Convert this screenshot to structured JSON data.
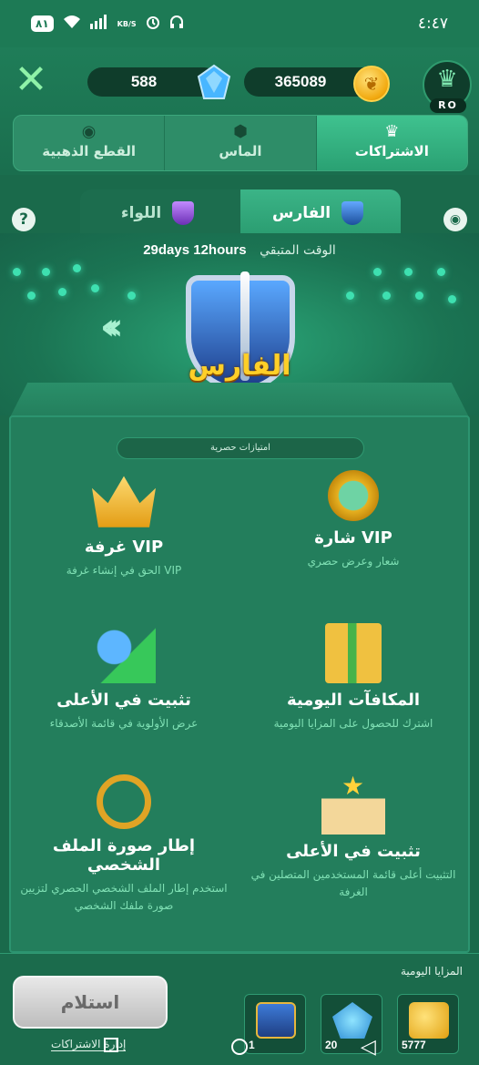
{
  "status": {
    "battery": "٨١",
    "speed_top": "KB/S",
    "clock": "٤:٤٧"
  },
  "header": {
    "diamonds": "588",
    "gold": "365089",
    "avatar_badge": "RO"
  },
  "tabs": [
    {
      "label": "القطع الذهبية",
      "icon": "coin-icon"
    },
    {
      "label": "الماس",
      "icon": "diamond-icon"
    },
    {
      "label": "الاشتراكات",
      "icon": "crown-icon"
    }
  ],
  "subtabs": {
    "active": "الفارس",
    "inactive": "اللواء"
  },
  "stage": {
    "remaining_label": "الوقت المتبقي",
    "remaining_value": "29days 12hours",
    "rank_name": "الفارس"
  },
  "panel": {
    "section_label": "امتيازات حصرية",
    "features": [
      {
        "title": "شارة VIP",
        "desc": "شعار وعرض حصري",
        "icon": "medal-icon"
      },
      {
        "title": "غرفة VIP",
        "desc": "الحق في إنشاء غرفة VIP",
        "icon": "crown-icon"
      },
      {
        "title": "المكافآت اليومية",
        "desc": "اشترك للحصول على المزايا اليومية",
        "icon": "gift-icon"
      },
      {
        "title": "تثبيت في الأعلى",
        "desc": "عرض الأولوية في قائمة الأصدقاء",
        "icon": "people-icon"
      },
      {
        "title": "تثبيت في الأعلى",
        "desc": "التثبيت أعلى قائمة المستخدمين المتصلين في الغرفة",
        "icon": "podium-icon"
      },
      {
        "title": "إطار صورة الملف الشخصي",
        "desc": "استخدم إطار الملف الشخصي الحصري لتزيين صورة ملفك الشخصي",
        "icon": "frame-icon"
      }
    ]
  },
  "bottom": {
    "daily_label": "المزايا اليومية",
    "claim_label": "استلام",
    "subs_link": "إدارة الاشتراكات",
    "rewards": [
      {
        "count": "5777",
        "icon": "coins-icon"
      },
      {
        "count": "20",
        "icon": "gems-icon"
      },
      {
        "count": "1",
        "icon": "chest-icon"
      }
    ]
  }
}
